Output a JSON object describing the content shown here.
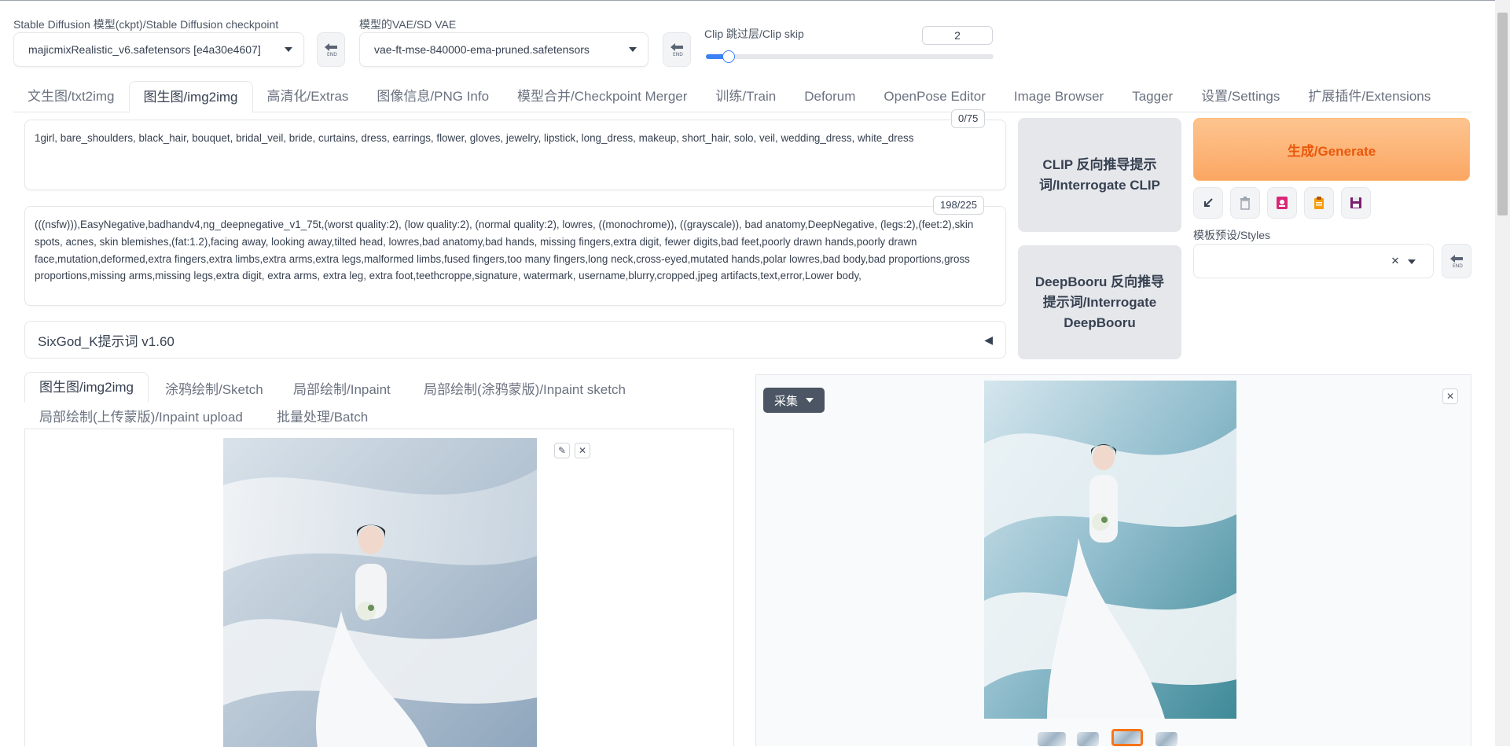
{
  "header": {
    "checkpoint_label": "Stable Diffusion 模型(ckpt)/Stable Diffusion checkpoint",
    "checkpoint_value": "majicmixRealistic_v6.safetensors [e4a30e4607]",
    "vae_label": "模型的VAE/SD VAE",
    "vae_value": "vae-ft-mse-840000-ema-pruned.safetensors",
    "clip_label": "Clip 跳过层/Clip skip",
    "clip_value": "2",
    "clip_slider_fraction": 0.08
  },
  "tabs": [
    {
      "label": "文生图/txt2img",
      "active": false
    },
    {
      "label": "图生图/img2img",
      "active": true
    },
    {
      "label": "高清化/Extras",
      "active": false
    },
    {
      "label": "图像信息/PNG Info",
      "active": false
    },
    {
      "label": "模型合并/Checkpoint Merger",
      "active": false
    },
    {
      "label": "训练/Train",
      "active": false
    },
    {
      "label": "Deforum",
      "active": false
    },
    {
      "label": "OpenPose Editor",
      "active": false
    },
    {
      "label": "Image Browser",
      "active": false
    },
    {
      "label": "Tagger",
      "active": false
    },
    {
      "label": "设置/Settings",
      "active": false
    },
    {
      "label": "扩展插件/Extensions",
      "active": false
    }
  ],
  "prompt": {
    "text": "1girl, bare_shoulders, black_hair, bouquet, bridal_veil, bride, curtains, dress, earrings, flower, gloves, jewelry, lipstick, long_dress, makeup, short_hair, solo, veil, wedding_dress, white_dress",
    "counter": "0/75"
  },
  "negative_prompt": {
    "text": "(((nsfw))),EasyNegative,badhandv4,ng_deepnegative_v1_75t,(worst quality:2), (low quality:2), (normal quality:2), lowres, ((monochrome)), ((grayscale)), bad anatomy,DeepNegative, (legs:2),(feet:2),skin spots, acnes, skin blemishes,(fat:1.2),facing away, looking away,tilted head, lowres,bad anatomy,bad hands, missing fingers,extra digit, fewer digits,bad feet,poorly drawn hands,poorly drawn face,mutation,deformed,extra fingers,extra limbs,extra arms,extra legs,malformed limbs,fused fingers,too many fingers,long neck,cross-eyed,mutated hands,polar lowres,bad body,bad proportions,gross proportions,missing arms,missing legs,extra digit, extra arms, extra leg, extra foot,teethcroppe,signature, watermark, username,blurry,cropped,jpeg artifacts,text,error,Lower body,",
    "counter": "198/225"
  },
  "buttons": {
    "interrogate_clip": "CLIP 反向推导提示词/Interrogate CLIP",
    "interrogate_deepbooru": "DeepBooru 反向推导提示词/Interrogate DeepBooru",
    "generate": "生成/Generate",
    "styles_label": "模板预设/Styles"
  },
  "sixgod": {
    "label": "SixGod_K提示词 v1.60",
    "arrow": "◀"
  },
  "subtabs": {
    "row1": [
      {
        "label": "图生图/img2img",
        "active": true
      },
      {
        "label": "涂鸦绘制/Sketch",
        "active": false
      },
      {
        "label": "局部绘制/Inpaint",
        "active": false
      },
      {
        "label": "局部绘制(涂鸦蒙版)/Inpaint sketch",
        "active": false
      }
    ],
    "row2": [
      {
        "label": "局部绘制(上传蒙版)/Inpaint upload",
        "active": false
      },
      {
        "label": "批量处理/Batch",
        "active": false
      }
    ]
  },
  "output": {
    "collect_label": "采集"
  },
  "colors": {
    "accent_blue": "#3b82f6",
    "generate_orange": "#ea580c"
  }
}
